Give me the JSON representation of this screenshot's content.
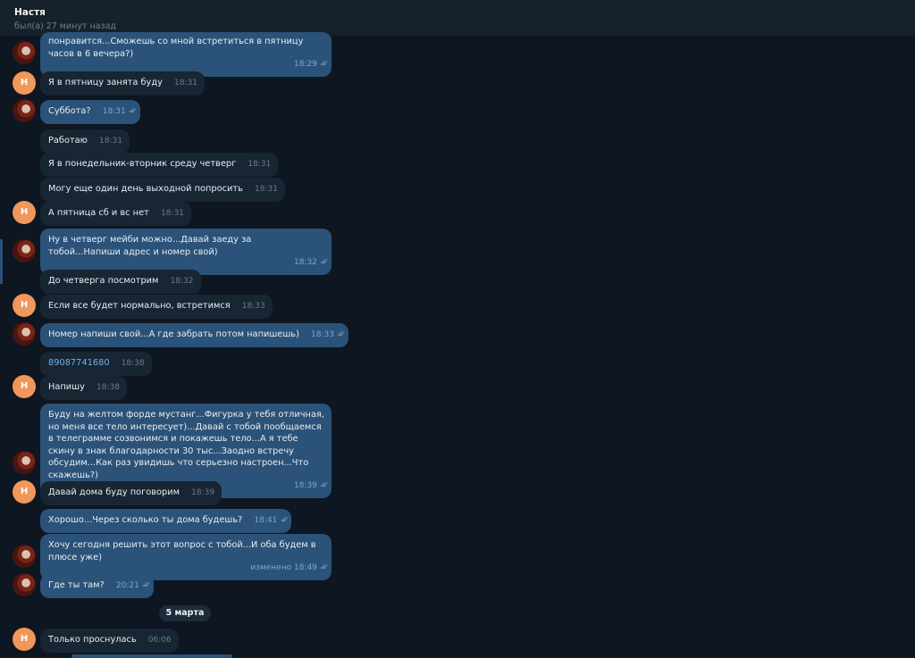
{
  "header": {
    "name": "Настя",
    "status": "был(а) 27 минут назад"
  },
  "avatar_letter": "Н",
  "date_divider": "5 марта",
  "messages": [
    {
      "dir": "out",
      "text": "понравится...Сможешь со мной встретиться в пятницу часов в 6 вечера?)",
      "time": "18:29"
    },
    {
      "dir": "in",
      "text": "Я в пятницу занята буду",
      "time": "18:31"
    },
    {
      "dir": "out",
      "text": "Суббота?",
      "time": "18:31"
    },
    {
      "dir": "in",
      "text": "Работаю",
      "time": "18:31"
    },
    {
      "dir": "in",
      "text": "Я в понедельник-вторник среду четверг",
      "time": "18:31"
    },
    {
      "dir": "in",
      "text": "Могу еще один день выходной попросить",
      "time": "18:31"
    },
    {
      "dir": "in",
      "text": "А пятница сб и вс нет",
      "time": "18:31"
    },
    {
      "dir": "out",
      "text": "Ну в четверг мейби можно...Давай заеду за тобой...Напиши адрес и номер свой)",
      "time": "18:32"
    },
    {
      "dir": "in",
      "text": "До четверга посмотрим",
      "time": "18:32"
    },
    {
      "dir": "in",
      "text": "Если все будет нормально, встретимся",
      "time": "18:33"
    },
    {
      "dir": "out",
      "text": "Номер напиши свой...А где забрать потом напишешь)",
      "time": "18:33"
    },
    {
      "dir": "in",
      "text": "89087741680",
      "time": "18:38"
    },
    {
      "dir": "in",
      "text": "Напишу",
      "time": "18:38"
    },
    {
      "dir": "out",
      "text": "Буду на желтом форде мустанг...Фигурка у тебя отличная, но меня все тело интересует)...Давай с тобой пообщаемся в телеграмме созвонимся и покажешь тело...А я тебе скину в знак благодарности 30 тыс...Заодно встречу обсудим...Как раз увидишь что серьезно настроен...Что скажешь?)",
      "time": "18:39"
    },
    {
      "dir": "in",
      "text": "Давай дома буду поговорим",
      "time": "18:39"
    },
    {
      "dir": "out",
      "text": "Хорошо...Через сколько ты дома будешь?",
      "time": "18:41"
    },
    {
      "dir": "out",
      "text": "Хочу сегодня решить этот вопрос с тобой...И оба будем в плюсе уже)",
      "time": "изменено 18:49"
    },
    {
      "dir": "out",
      "text": "Где ты там?",
      "time": "20:21"
    },
    {
      "dir": "in",
      "text": "Только проснулась",
      "time": "06:06"
    }
  ]
}
